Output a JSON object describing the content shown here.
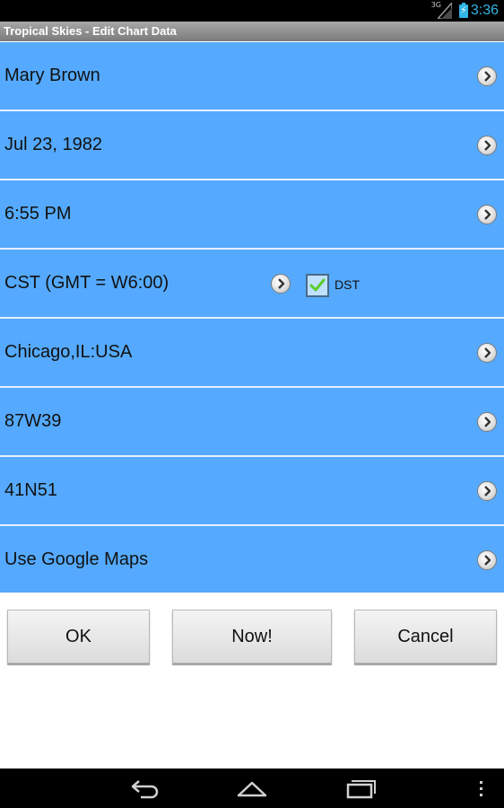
{
  "status_bar": {
    "signal_label": "3G",
    "time": "3:36"
  },
  "title_bar": {
    "title": "Tropical Skies - Edit Chart Data"
  },
  "rows": [
    {
      "label": "Mary Brown",
      "icon": "chevron-right-icon"
    },
    {
      "label": "Jul 23, 1982",
      "icon": "chevron-right-icon"
    },
    {
      "label": "6:55 PM",
      "icon": "chevron-right-icon"
    },
    {
      "label": "CST (GMT = W6:00)",
      "icon": "chevron-right-icon",
      "dst": {
        "label": "DST",
        "checked": true
      }
    },
    {
      "label": "Chicago,IL:USA",
      "icon": "chevron-right-icon"
    },
    {
      "label": "87W39",
      "icon": "chevron-right-icon"
    },
    {
      "label": "41N51",
      "icon": "chevron-right-icon"
    },
    {
      "label": "Use Google Maps",
      "icon": "chevron-right-icon"
    }
  ],
  "buttons": {
    "ok": "OK",
    "now": "Now!",
    "cancel": "Cancel"
  },
  "colors": {
    "row_background": "#55aaff",
    "status_accent": "#33b5e5"
  },
  "nav_bar": {
    "icons": [
      "back-icon",
      "home-icon",
      "recent-apps-icon",
      "overflow-menu-icon"
    ]
  }
}
